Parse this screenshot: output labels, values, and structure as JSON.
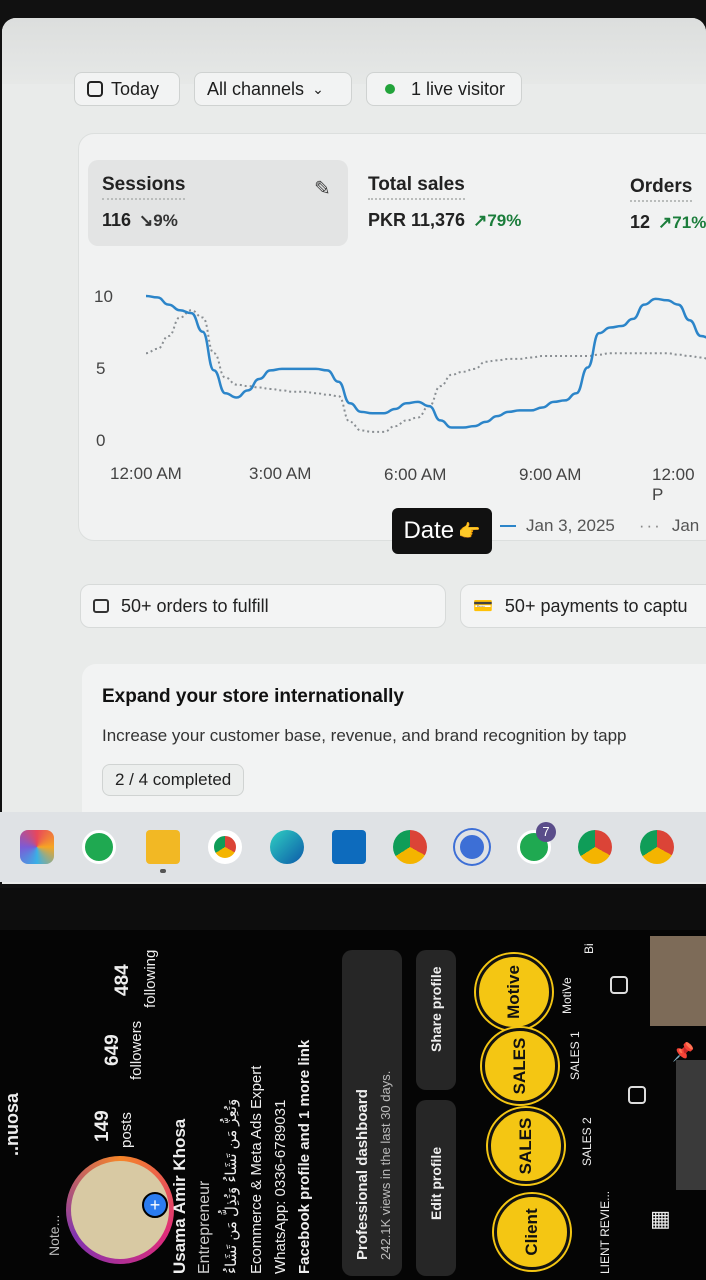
{
  "filters": {
    "today": "Today",
    "channels": "All channels",
    "live": "1 live visitor"
  },
  "metrics": {
    "sessions": {
      "title": "Sessions",
      "value": "116",
      "change": "9%"
    },
    "sales": {
      "title": "Total sales",
      "value": "PKR 11,376",
      "change": "79%"
    },
    "orders": {
      "title": "Orders",
      "value": "12",
      "change": "71%"
    }
  },
  "chart_data": {
    "type": "line",
    "y_ticks": [
      "10",
      "5",
      "0"
    ],
    "x_ticks": [
      "12:00 AM",
      "3:00 AM",
      "6:00 AM",
      "9:00 AM",
      "12:00 P"
    ],
    "ylim": [
      0,
      10
    ],
    "x": [
      0,
      0.25,
      0.5,
      0.75,
      1,
      1.25,
      1.5,
      1.75,
      2,
      2.25,
      2.5,
      2.75,
      3,
      3.25,
      3.5,
      3.75,
      4,
      4.25,
      4.5,
      4.75,
      5,
      5.25,
      5.5,
      5.75,
      6,
      6.25,
      6.5,
      6.75,
      7,
      7.25,
      7.5,
      7.75,
      8,
      8.25,
      8.5,
      8.75,
      9,
      9.25,
      9.5,
      9.75,
      10,
      10.25,
      10.5,
      10.75,
      11,
      11.25,
      11.5,
      11.75,
      12,
      12.25,
      12.5,
      12.75,
      13,
      13.25
    ],
    "series": [
      {
        "name": "Jan 3, 2025",
        "style": "solid",
        "color": "#2c85c9",
        "values": [
          10,
          9.9,
          9.4,
          9,
          8.8,
          7.5,
          4.8,
          3.2,
          2.9,
          3.4,
          4.2,
          4.8,
          4.9,
          4.9,
          4.9,
          4.9,
          4.8,
          4,
          2.5,
          1.9,
          1.8,
          1.8,
          2.1,
          2.5,
          2.6,
          2.3,
          1.3,
          0.8,
          0.8,
          0.9,
          1.2,
          1.6,
          1.9,
          2,
          2,
          2.2,
          2.6,
          2.7,
          3.2,
          5,
          7.4,
          7.8,
          7.9,
          8.4,
          9.4,
          9.8,
          9.7,
          9.4,
          8.3,
          7.2,
          7,
          7.1,
          7.2,
          7.2
        ]
      },
      {
        "name": "Jan",
        "style": "dotted",
        "color": "#8a8f93",
        "values": [
          6,
          6.3,
          7.2,
          8.5,
          9,
          8.5,
          6,
          4.3,
          3.8,
          3.7,
          3.6,
          3.5,
          3.4,
          3.3,
          3.3,
          3.2,
          3.1,
          3,
          1.2,
          0.6,
          0.5,
          0.5,
          0.9,
          1.3,
          1.5,
          2.3,
          3.7,
          4.5,
          4.7,
          4.9,
          5.4,
          5.5,
          5.6,
          5.6,
          5.7,
          5.8,
          5.8,
          5.8,
          5.8,
          5.8,
          5.9,
          6,
          6,
          6,
          6,
          6,
          6,
          5.9,
          5.8,
          5.7,
          5.5,
          4.9,
          4.8,
          4.8
        ]
      }
    ]
  },
  "date_badge": {
    "label": "Date",
    "emoji": "👉"
  },
  "legend": {
    "current": "Jan 3, 2025",
    "previous": "Jan"
  },
  "tasks": {
    "orders": "50+ orders to fulfill",
    "payments": "50+ payments to captu"
  },
  "expand": {
    "title": "Expand your store internationally",
    "desc": "Increase your customer base, revenue, and brand recognition by tapp",
    "progress": "2 / 4 completed"
  },
  "taskbar": {
    "whatsapp_badge": "7"
  },
  "phone": {
    "username": "..nuosa",
    "note": "Note...",
    "posts_count": "149",
    "posts_label": "posts",
    "followers_count": "649",
    "followers_label": "followers",
    "following_count": "484",
    "following_label": "following",
    "name": "Usama Amir Khosa",
    "category": "Entrepreneur",
    "arabic": "وَتُعِزُّ مَن تَشَاءُ وَتُذِلُّ مَن تَشَاءُ",
    "bio1": "Ecommerce & Meta Ads Expert",
    "bio2": "WhatsApp: 0336-6789031",
    "bio3": "Facebook profile and 1 more link",
    "dash_title": "Professional dashboard",
    "dash_sub": "242.1K views in the last 30 days.",
    "edit": "Edit profile",
    "share": "Share profile",
    "highlights": [
      {
        "cover": "Motive",
        "label": "MotiVe"
      },
      {
        "cover": "SALES",
        "label": "SALES 1"
      },
      {
        "cover": "SALES",
        "label": "SALES 2"
      },
      {
        "cover": "Client",
        "label": "LIENT REVIE..."
      }
    ],
    "bi": "Bi"
  }
}
